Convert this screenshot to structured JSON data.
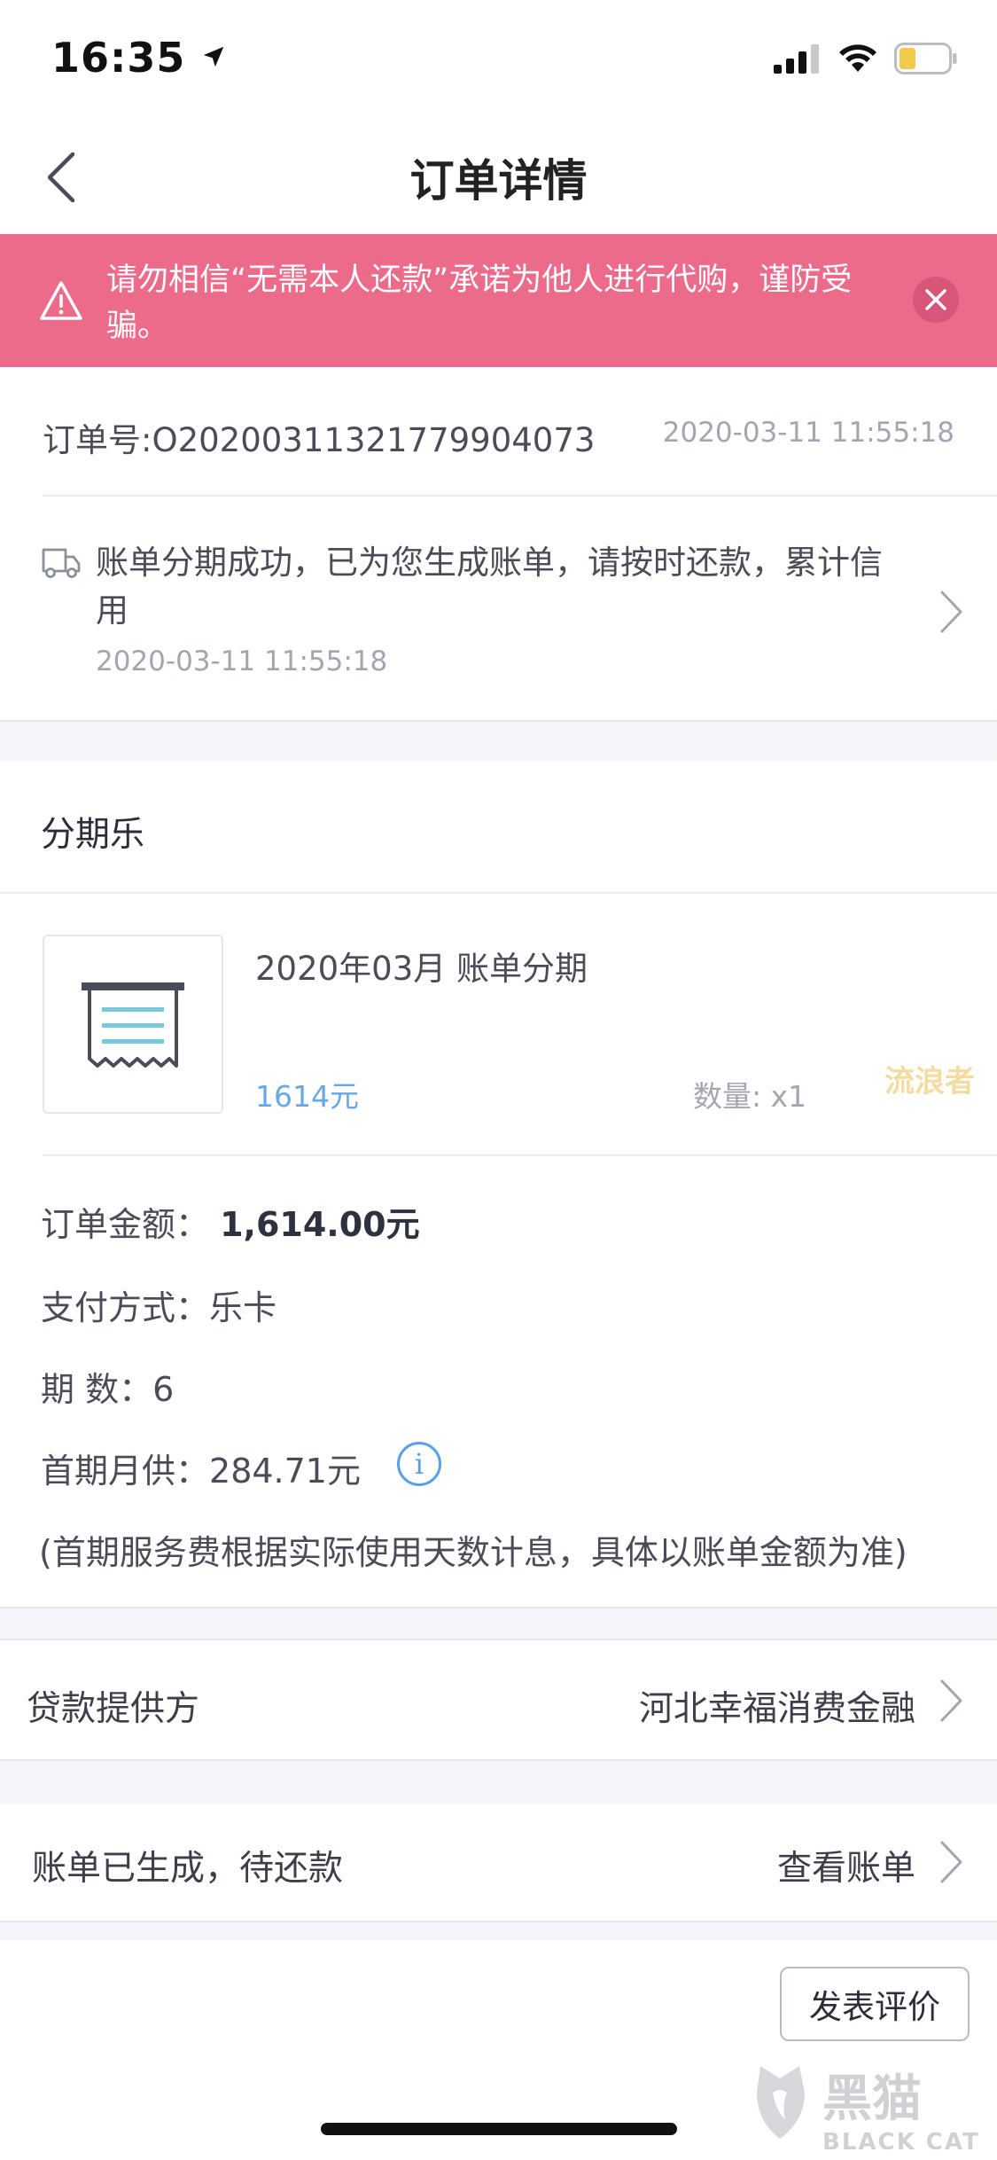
{
  "status_bar": {
    "time": "16:35"
  },
  "nav": {
    "title": "订单详情"
  },
  "banner": {
    "text": "请勿相信“无需本人还款”承诺为他人进行代购，谨防受骗。"
  },
  "order": {
    "number": "订单号:O202003113217799040​73",
    "time": "2020-03-11 11:55:18"
  },
  "status": {
    "message": "账单分期成功，已为您生成账单，请按时还款，累计信用",
    "time": "2020-03-11 11:55:18"
  },
  "section": {
    "title": "分期乐"
  },
  "product": {
    "title": "2020年03月 账单分期",
    "price": "1614元",
    "quantity": "数量: x1",
    "watermark": "流浪者"
  },
  "details": {
    "amount_label": "订单金额：",
    "amount_value": "1,614.00元",
    "payment_label": "支付方式：",
    "payment_value": "乐卡",
    "periods_label": "期 数：",
    "periods_value": "6",
    "first_payment_label": "首期月供：",
    "first_payment_value": "284.71元",
    "info_glyph": "i",
    "note": "(首期服务费根据实际使用天数计息，具体以账单金额为准)"
  },
  "lender": {
    "label": "贷款提供方",
    "value": "河北幸福消费金融"
  },
  "bill": {
    "label": "账单已生成，待还款",
    "action": "查看账单"
  },
  "review": {
    "label": "发表评价"
  },
  "logo": {
    "text": "黑猫",
    "subtext": "BLACK CAT"
  },
  "colors": {
    "banner": "#ec6b8a",
    "price": "#6aa7e6",
    "info": "#5aa0e6",
    "background_gap": "#f4f5f8"
  }
}
